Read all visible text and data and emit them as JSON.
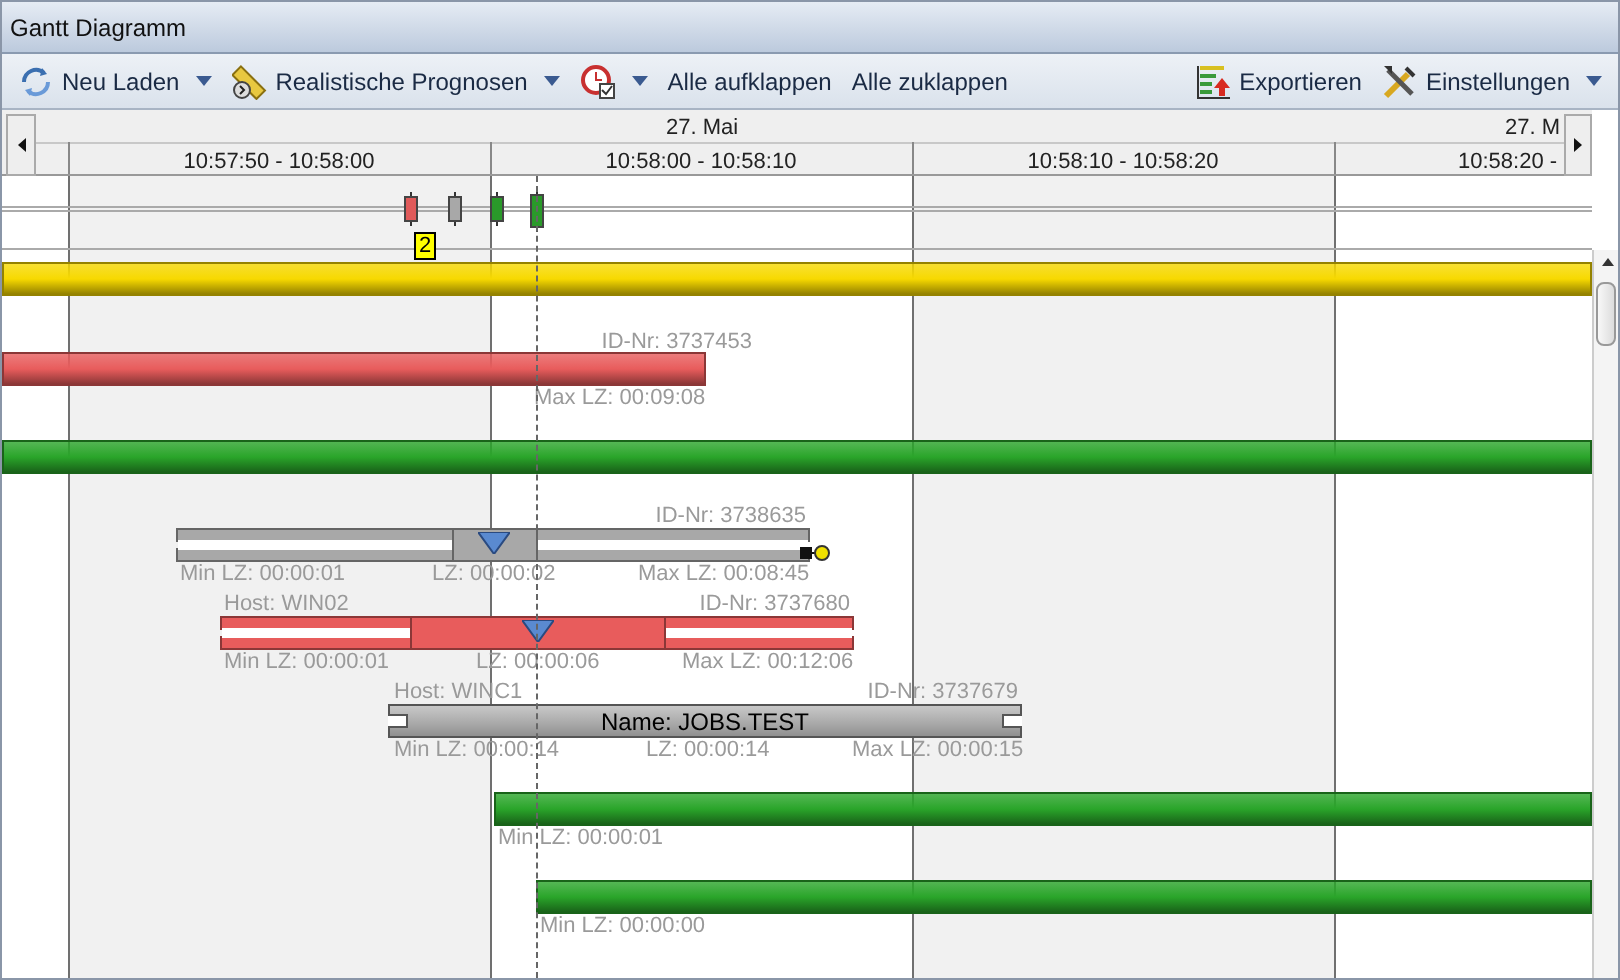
{
  "window": {
    "title": "Gantt Diagramm"
  },
  "toolbar": {
    "left": [
      {
        "label": "Neu Laden",
        "dropdown": true
      },
      {
        "label": "Realistische Prognosen",
        "dropdown": true
      },
      {
        "dropdown": true
      },
      {
        "label": "Alle aufklappen",
        "dropdown": false
      },
      {
        "label": "Alle zuklappen",
        "dropdown": false
      }
    ],
    "right": [
      {
        "label": "Exportieren",
        "dropdown": false
      },
      {
        "label": "Einstellungen",
        "dropdown": true
      }
    ]
  },
  "timeline": {
    "dates": [
      "27. Mai",
      "27. M"
    ],
    "columns": [
      {
        "label": "10:57:50 - 10:58:00",
        "shaded": true
      },
      {
        "label": "10:58:00 - 10:58:10",
        "shaded": false
      },
      {
        "label": "10:58:10 - 10:58:20",
        "shaded": true
      },
      {
        "label": "10:58:20 -",
        "shaded": false
      }
    ]
  },
  "summary": {
    "markers": [
      {
        "color": "#e05a5a"
      },
      {
        "color": "#a8a8a8"
      },
      {
        "color": "#2a9a2a"
      },
      {
        "color": "#2a9a2a"
      }
    ],
    "badge": "2"
  },
  "rows": [
    {
      "kind": "bar",
      "color": "#f7d900"
    },
    {
      "kind": "bar",
      "color": "#e85c5c",
      "id": "ID-Nr: 3737453",
      "max": "Max LZ: 00:09:08"
    },
    {
      "kind": "bar",
      "color": "#2aa52a"
    },
    {
      "kind": "split",
      "color": "#a8a8a8",
      "id": "ID-Nr: 3738635",
      "min": "Min LZ: 00:00:01",
      "lz": "LZ: 00:00:02",
      "max": "Max LZ: 00:08:45",
      "linked": true
    },
    {
      "kind": "split",
      "color": "#e85c5c",
      "host": "Host: WIN02",
      "id": "ID-Nr: 3737680",
      "min": "Min LZ: 00:00:01",
      "lz": "LZ: 00:00:06",
      "max": "Max LZ: 00:12:06"
    },
    {
      "kind": "named",
      "color": "#a8a8a8",
      "host": "Host: WINC1",
      "id": "ID-Nr: 3737679",
      "name": "Name: JOBS.TEST",
      "min": "Min LZ: 00:00:14",
      "lz": "LZ: 00:00:14",
      "max": "Max LZ: 00:00:15"
    },
    {
      "kind": "bar",
      "color": "#2aa52a",
      "min": "Min LZ: 00:00:01"
    },
    {
      "kind": "bar",
      "color": "#2aa52a",
      "min": "Min LZ: 00:00:00"
    }
  ]
}
